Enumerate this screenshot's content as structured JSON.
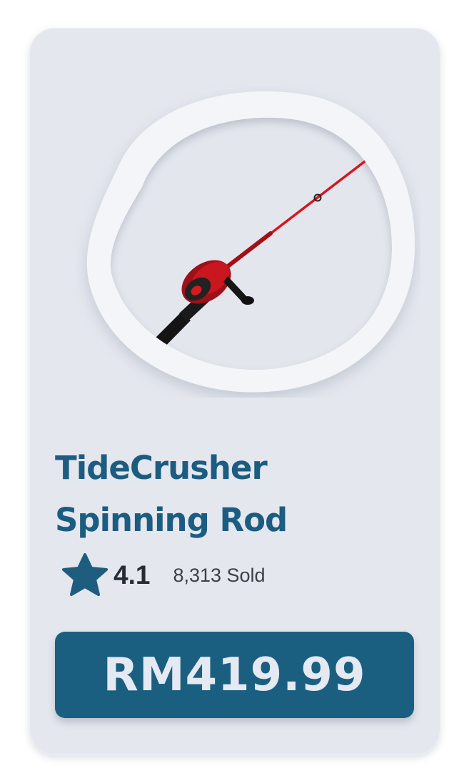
{
  "product": {
    "title_line1": "TideCrusher",
    "title_line2": "Spinning Rod",
    "rating": "4.1",
    "sold": "8,313 Sold",
    "price": "RM419.99",
    "image_icon": "fishing-rod-icon"
  },
  "colors": {
    "card_background": "#e4e7ee",
    "title": "#1c5c80",
    "star": "#1f5d7f",
    "price_button": "#1b5f80",
    "price_text": "#e4e9f2",
    "rod_blank": "#d8151e",
    "reel": "#b0141c",
    "handle": "#1a1a1a"
  }
}
